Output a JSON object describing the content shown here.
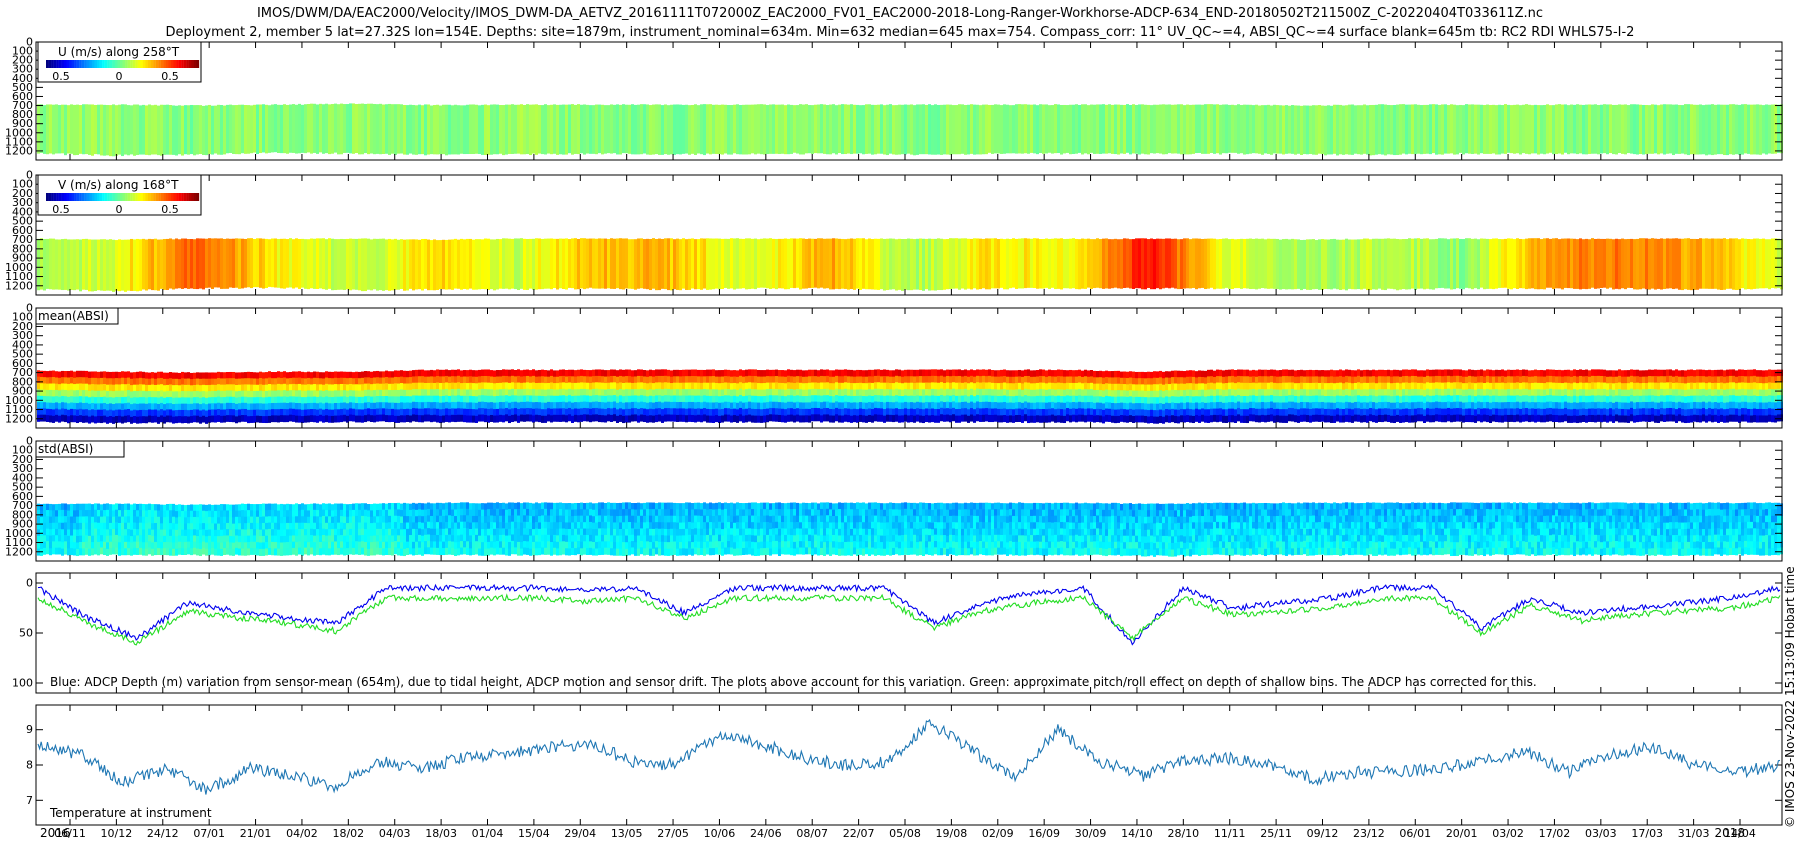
{
  "header": {
    "title_line1": "IMOS/DWM/DA/EAC2000/Velocity/IMOS_DWM-DA_AETVZ_20161111T072000Z_EAC2000_FV01_EAC2000-2018-Long-Ranger-Workhorse-ADCP-634_END-20180502T211500Z_C-20220404T033611Z.nc",
    "title_line2": "Deployment 2, member 5 lat=27.32S lon=154E. Depths: site=1879m, instrument_nominal=634m. Min=632 median=645 max=754. Compass_corr: 11° UV_QC~=4, ABSI_QC~=4 surface blank=645m tb: RC2 RDI WHLS75-I-2"
  },
  "side_label": "© IMOS 23-Nov-2022 15:13:09 Hobart time",
  "colors": {
    "axis": "#000000",
    "adcp_depth": "#0000ee",
    "pitch_roll": "#22dd22",
    "temperature": "#1f77b4"
  },
  "chart_data": [
    {
      "type": "heatmap",
      "title": "U (m/s) along 258°T",
      "colorbar_ticks": [
        "0.5",
        "0",
        "0.5"
      ],
      "colormap": "jet",
      "value_range": [
        -0.75,
        0.75
      ],
      "y_ticks": [
        "0",
        "100",
        "200",
        "300",
        "400",
        "500",
        "600",
        "700",
        "800",
        "900",
        "1000",
        "1100",
        "1200"
      ],
      "ylim": [
        0,
        1300
      ],
      "y_reversed": true,
      "top_depth": [
        690,
        690,
        700,
        690,
        680,
        695,
        690,
        690,
        690,
        690,
        690,
        690,
        690,
        690,
        690,
        690,
        700,
        690,
        690,
        690,
        690,
        690,
        690
      ],
      "bottom_depth": [
        1230,
        1250,
        1240,
        1220,
        1230,
        1240,
        1240,
        1230,
        1240,
        1230,
        1230,
        1240,
        1230,
        1230,
        1230,
        1230,
        1240,
        1240,
        1230,
        1230,
        1230,
        1240,
        1230
      ],
      "values": [
        0.02,
        0.03,
        0.0,
        0.02,
        0.02,
        0.01,
        0.03,
        0.02,
        0.01,
        0.02,
        0.03,
        0.0,
        0.02,
        0.01,
        0.02,
        0.03,
        0.02,
        0.01,
        0.02,
        0.02,
        0.01,
        0.02,
        0.03
      ],
      "grid": false
    },
    {
      "type": "heatmap",
      "title": "V (m/s) along 168°T",
      "colorbar_ticks": [
        "0.5",
        "0",
        "0.5"
      ],
      "colormap": "jet",
      "value_range": [
        -0.75,
        0.75
      ],
      "y_ticks": [
        "0",
        "100",
        "200",
        "300",
        "400",
        "500",
        "600",
        "700",
        "800",
        "900",
        "1000",
        "1100",
        "1200"
      ],
      "ylim": [
        0,
        1300
      ],
      "y_reversed": true,
      "top_depth": [
        690,
        700,
        690,
        690,
        690,
        700,
        690,
        690,
        690,
        690,
        690,
        690,
        690,
        690,
        690,
        690,
        700,
        690,
        690,
        690,
        690,
        690,
        690
      ],
      "bottom_depth": [
        1240,
        1260,
        1230,
        1220,
        1250,
        1240,
        1240,
        1230,
        1240,
        1230,
        1230,
        1250,
        1230,
        1230,
        1230,
        1230,
        1240,
        1240,
        1230,
        1230,
        1230,
        1240,
        1230
      ],
      "values": [
        0.05,
        0.15,
        0.45,
        0.2,
        0.08,
        0.25,
        0.1,
        0.3,
        0.28,
        0.12,
        0.32,
        0.05,
        0.22,
        0.18,
        0.55,
        0.15,
        0.05,
        0.1,
        0.02,
        0.35,
        0.4,
        0.3,
        0.1
      ],
      "grid": false
    },
    {
      "type": "heatmap",
      "title": "mean(ABSI)",
      "colormap": "jet",
      "y_ticks": [
        "0",
        "100",
        "200",
        "300",
        "400",
        "500",
        "600",
        "700",
        "800",
        "900",
        "1000",
        "1100",
        "1200"
      ],
      "ylim": [
        0,
        1300
      ],
      "y_reversed": true,
      "top_depth": [
        680,
        690,
        700,
        690,
        690,
        670,
        670,
        670,
        670,
        670,
        670,
        670,
        670,
        670,
        690,
        670,
        670,
        670,
        670,
        670,
        670,
        670,
        670
      ],
      "bottom_depth": [
        1230,
        1240,
        1240,
        1230,
        1230,
        1230,
        1230,
        1230,
        1230,
        1230,
        1230,
        1230,
        1230,
        1230,
        1240,
        1230,
        1230,
        1230,
        1230,
        1230,
        1230,
        1230,
        1230
      ],
      "grid": false
    },
    {
      "type": "heatmap",
      "title": "std(ABSI)",
      "colormap": "jet",
      "y_ticks": [
        "0",
        "100",
        "200",
        "300",
        "400",
        "500",
        "600",
        "700",
        "800",
        "900",
        "1000",
        "1100",
        "1200"
      ],
      "ylim": [
        0,
        1300
      ],
      "y_reversed": true,
      "top_depth": [
        680,
        680,
        690,
        680,
        680,
        670,
        670,
        670,
        670,
        670,
        670,
        670,
        670,
        670,
        680,
        670,
        670,
        670,
        670,
        670,
        670,
        670,
        670
      ],
      "bottom_depth": [
        1230,
        1230,
        1230,
        1230,
        1230,
        1230,
        1230,
        1230,
        1230,
        1230,
        1230,
        1230,
        1230,
        1230,
        1240,
        1230,
        1230,
        1230,
        1230,
        1230,
        1230,
        1230,
        1230
      ],
      "grid": false
    },
    {
      "type": "line",
      "caption": "Blue: ADCP Depth (m) variation from sensor-mean (654m), due to tidal height, ADCP motion and sensor drift. The plots above account for this variation. Green: approximate pitch/roll effect on depth of shallow bins. The ADCP has corrected for this.",
      "y_ticks": [
        "0",
        "50",
        "100"
      ],
      "ylim": [
        -10,
        110
      ],
      "y_reversed": true,
      "series": [
        {
          "values": [
            5,
            35,
            55,
            20,
            28,
            35,
            40,
            5,
            5,
            5,
            5,
            8,
            5,
            30,
            5,
            5,
            5,
            5,
            40,
            20,
            10,
            5,
            60,
            5,
            25,
            20,
            15,
            5,
            5,
            45,
            15,
            30,
            25,
            20,
            15,
            5
          ]
        },
        {
          "values": [
            15,
            40,
            60,
            28,
            35,
            40,
            48,
            15,
            15,
            15,
            15,
            18,
            15,
            35,
            15,
            15,
            15,
            15,
            45,
            28,
            20,
            15,
            55,
            15,
            32,
            28,
            25,
            15,
            15,
            50,
            22,
            38,
            32,
            28,
            25,
            15
          ]
        }
      ]
    },
    {
      "type": "line",
      "caption": "Temperature at instrument",
      "y_ticks": [
        "7",
        "8",
        "9"
      ],
      "ylim": [
        6.3,
        9.7
      ],
      "series": [
        {
          "values": [
            8.6,
            8.3,
            7.5,
            7.9,
            7.3,
            7.9,
            7.7,
            7.4,
            8.1,
            7.9,
            8.2,
            8.3,
            8.5,
            8.6,
            8.1,
            8.0,
            8.8,
            8.6,
            8.2,
            8.0,
            8.1,
            9.2,
            8.4,
            7.6,
            9.0,
            8.1,
            7.7,
            8.1,
            8.2,
            8.0,
            7.6,
            7.8,
            7.8,
            7.9,
            8.1,
            8.4,
            7.8,
            8.3,
            8.5,
            8.0,
            7.8,
            8.0
          ]
        }
      ]
    }
  ],
  "x_axis": {
    "tick_labels": [
      "06/11",
      "10/12",
      "24/12",
      "07/01",
      "21/01",
      "04/02",
      "18/02",
      "04/03",
      "18/03",
      "01/04",
      "15/04",
      "29/04",
      "13/05",
      "27/05",
      "10/06",
      "24/06",
      "08/07",
      "22/07",
      "05/08",
      "19/08",
      "02/09",
      "16/09",
      "30/09",
      "14/10",
      "28/10",
      "11/11",
      "25/11",
      "09/12",
      "23/12",
      "06/01",
      "20/01",
      "03/02",
      "17/02",
      "03/03",
      "17/03",
      "31/03",
      "14/04"
    ],
    "year_start": "2016",
    "year_end": "2018"
  }
}
